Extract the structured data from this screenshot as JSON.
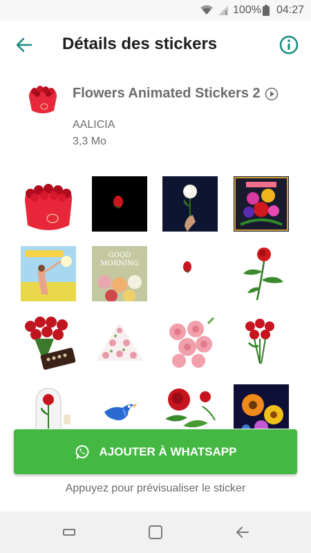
{
  "status_bar": {
    "battery": "100%",
    "time": "04:27",
    "icons": [
      "wifi-icon",
      "signal-icon",
      "battery-icon"
    ]
  },
  "app_bar": {
    "title": "Détails des stickers",
    "back_icon": "arrow-left-icon",
    "info_icon": "info-circle-icon"
  },
  "pack": {
    "name": "Flowers Animated Stickers 2",
    "publisher": "AALICIA",
    "size": "3,3 Mo"
  },
  "stickers": [
    "rose-heart-box",
    "rose-on-black",
    "white-rose-in-hand",
    "flower-bouquet-card",
    "good-morning-girl-card",
    "good-morning-flowers-card",
    "single-rose-petal",
    "red-rose-stem",
    "roses-with-chocolates",
    "floral-triangle",
    "pink-roses-cluster",
    "red-rose-bouquet",
    "rose-in-glass-dome",
    "blue-bird",
    "red-roses-leaves",
    "gerbera-flowers"
  ],
  "add_button": {
    "label": "AJOUTER À WHATSAPP",
    "icon": "whatsapp-icon"
  },
  "hint": "Appuyez pour prévisualiser le sticker",
  "colors": {
    "accent": "#128c7e",
    "button": "#44b843"
  }
}
